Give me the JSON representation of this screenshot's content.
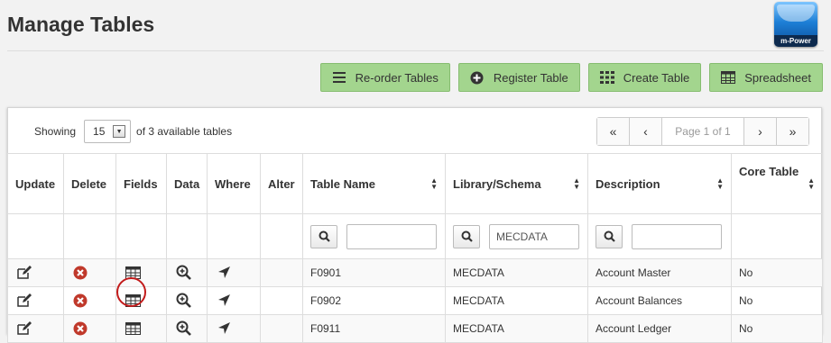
{
  "page": {
    "title": "Manage Tables",
    "logo_text": "m-Power"
  },
  "toolbar": [
    {
      "label": "Re-order Tables",
      "icon": "list-icon"
    },
    {
      "label": "Register Table",
      "icon": "plus-circle-icon"
    },
    {
      "label": "Create Table",
      "icon": "grid-icon"
    },
    {
      "label": "Spreadsheet",
      "icon": "table-icon"
    }
  ],
  "listing": {
    "showing_label": "Showing",
    "page_size": "15",
    "available_label": "of 3 available tables"
  },
  "pager": {
    "first": "«",
    "prev": "‹",
    "info": "Page 1 of 1",
    "next": "›",
    "last": "»"
  },
  "columns": {
    "update": "Update",
    "delete": "Delete",
    "fields": "Fields",
    "data": "Data",
    "where": "Where",
    "alter": "Alter",
    "table_name": "Table Name",
    "library": "Library/Schema",
    "description": "Description",
    "core": "Core Table"
  },
  "filters": {
    "table_name": "",
    "library": "MECDATA",
    "description": ""
  },
  "rows": [
    {
      "table_name": "F0901",
      "library": "MECDATA",
      "description": "Account Master",
      "core": "No"
    },
    {
      "table_name": "F0902",
      "library": "MECDATA",
      "description": "Account Balances",
      "core": "No"
    },
    {
      "table_name": "F0911",
      "library": "MECDATA",
      "description": "Account Ledger",
      "core": "No"
    }
  ],
  "colors": {
    "button_green": "#a3d58e",
    "delete_red": "#c0392b",
    "highlight_circle": "#c21b1b"
  }
}
